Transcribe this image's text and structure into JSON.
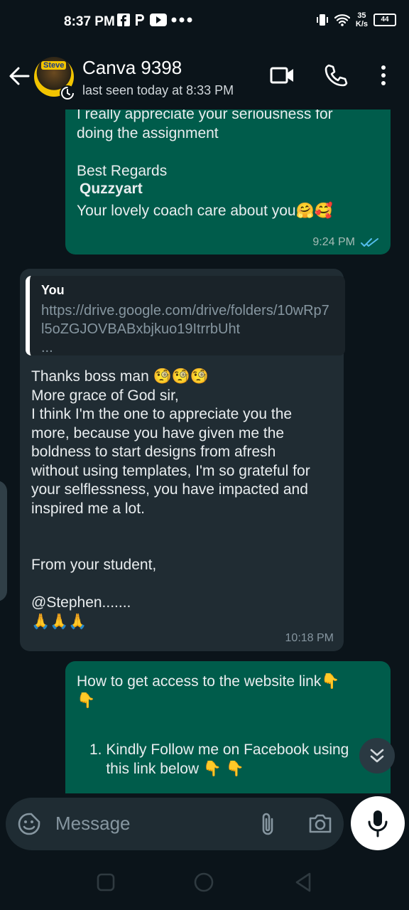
{
  "status_bar": {
    "time": "8:37 PM",
    "net_speed_value": "35",
    "net_speed_unit": "K/s",
    "battery": "44",
    "icons": [
      "facebook-icon",
      "p-icon",
      "youtube-icon",
      "more-dots-icon",
      "vibrate-icon",
      "wifi-icon"
    ]
  },
  "header": {
    "contact_name": "Canva 9398",
    "last_seen": "last seen today at 8:33 PM",
    "avatar_text": "Steve"
  },
  "messages": [
    {
      "direction": "out",
      "text": "I really appreciate your seriousness for\ndoing the assignment\n\nBest Regards",
      "bold_line": "Quzzyart",
      "closing": "Your lovely coach care about you🤗🥰",
      "time": "9:24 PM"
    },
    {
      "direction": "in",
      "quote_author": "You",
      "quote_text": "https://drive.google.com/drive/folders/10wRp7l5oZGJOVBABxbjkuo19ItrrbUht\n...",
      "text": "Thanks boss man 🧐🧐🧐\nMore grace of God sir,\nI think I'm the one to appreciate you the\nmore, because you have given me the\nboldness to start designs from afresh\nwithout using templates, I'm so grateful for\nyour selflessness, you have impacted and\ninspired me a lot.\n\n\nFrom your student,\n\n@Stephen.......\n🙏🙏🙏",
      "time": "10:18 PM"
    },
    {
      "direction": "out",
      "text": "How to get access to the website link👇\n👇",
      "list_item": "1. Kindly Follow me on Facebook using\n    this link below 👇 👇"
    }
  ],
  "composer": {
    "placeholder": "Message"
  },
  "colors": {
    "background": "#0b141a",
    "outgoing_bubble": "#005c4b",
    "incoming_bubble": "#202c33",
    "read_ticks": "#53bdeb"
  }
}
